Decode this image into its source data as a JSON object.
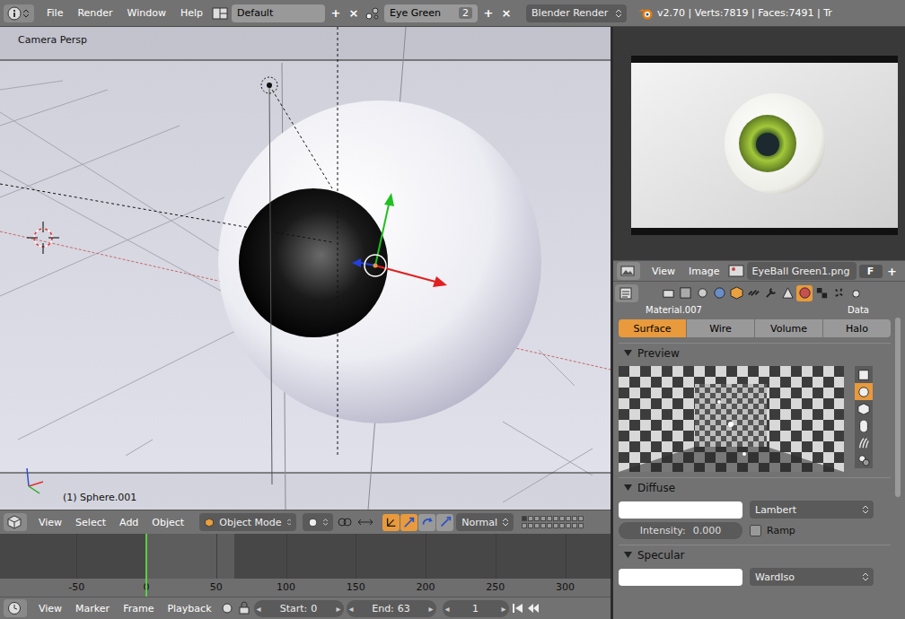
{
  "top_bar": {
    "menus": [
      "File",
      "Render",
      "Window",
      "Help"
    ],
    "screen": "Default",
    "scene": "Eye Green",
    "scene_users": "2",
    "add": "+",
    "close": "×",
    "engine": "Blender Render",
    "stats": "v2.70 | Verts:7819 | Faces:7491 | Tr"
  },
  "viewport": {
    "view_label": "Camera Persp",
    "object_label": "(1) Sphere.001"
  },
  "viewport_header": {
    "menus": [
      "View",
      "Select",
      "Add",
      "Object"
    ],
    "mode": "Object Mode",
    "orientation": "Normal",
    "manipulators": [
      {
        "selected": true
      },
      {
        "selected": true
      },
      {
        "selected": false
      },
      {
        "selected": false
      }
    ],
    "layers": [
      {
        "on": true
      },
      {
        "on": false
      },
      {
        "on": false
      },
      {
        "on": false
      },
      {
        "on": false
      },
      {
        "on": false
      },
      {
        "on": false
      },
      {
        "on": false
      },
      {
        "on": false
      },
      {
        "on": false
      },
      {
        "on": false
      },
      {
        "on": false
      },
      {
        "on": false
      },
      {
        "on": false
      },
      {
        "on": false
      },
      {
        "on": false
      },
      {
        "on": false
      },
      {
        "on": false
      },
      {
        "on": false
      },
      {
        "on": false
      }
    ]
  },
  "timeline": {
    "ticks": [
      "-50",
      "0",
      "50",
      "100",
      "150",
      "200",
      "250",
      "300"
    ],
    "playhead": 0
  },
  "timeline_header": {
    "menus": [
      "View",
      "Marker",
      "Frame",
      "Playback"
    ],
    "start_label": "Start:",
    "start": "0",
    "end_label": "End:",
    "end": "63",
    "frame": "1"
  },
  "image_editor": {
    "menus": [
      "View",
      "Image"
    ],
    "image": "EyeBall Green1.png",
    "fake_user": "F",
    "add": "+"
  },
  "properties": {
    "context_tabs": [
      {
        "selected": false
      },
      {
        "selected": false
      },
      {
        "selected": false
      },
      {
        "selected": false
      },
      {
        "selected": false
      },
      {
        "selected": false
      },
      {
        "selected": false
      },
      {
        "selected": false
      },
      {
        "selected": true
      },
      {
        "selected": false
      },
      {
        "selected": false
      },
      {
        "selected": false
      }
    ],
    "material": "Material.007",
    "data": "Data",
    "tabs": [
      {
        "label": "Surface",
        "selected": true
      },
      {
        "label": "Wire",
        "selected": false
      },
      {
        "label": "Volume",
        "selected": false
      },
      {
        "label": "Halo",
        "selected": false
      }
    ],
    "preview": {
      "title": "Preview",
      "shapes": [
        {
          "selected": false
        },
        {
          "selected": true
        },
        {
          "selected": false
        },
        {
          "selected": false
        },
        {
          "selected": false
        },
        {
          "selected": false
        }
      ]
    },
    "diffuse": {
      "title": "Diffuse",
      "shader": "Lambert",
      "intensity_label": "Intensity:",
      "intensity": "0.000",
      "level": 0,
      "ramp_label": "Ramp",
      "ramp": false
    },
    "specular": {
      "title": "Specular",
      "shader": "WardIso"
    }
  }
}
